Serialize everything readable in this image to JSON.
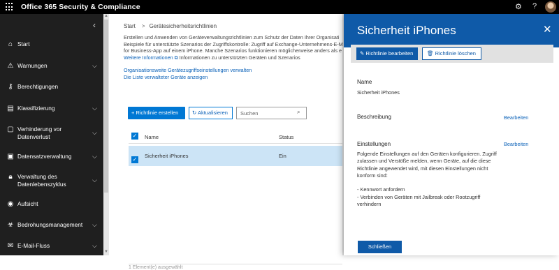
{
  "app": {
    "title": "Office 365 Security & Compliance"
  },
  "topbar_icons": [
    "gear-icon",
    "help-icon",
    "avatar"
  ],
  "nav": {
    "items": [
      {
        "label": "Start",
        "icon": "home-icon",
        "expandable": false
      },
      {
        "label": "Warnungen",
        "icon": "warning-icon",
        "expandable": true
      },
      {
        "label": "Berechtigungen",
        "icon": "key-icon",
        "expandable": false
      },
      {
        "label": "Klassifizierung",
        "icon": "tag-icon",
        "expandable": true
      },
      {
        "label": "Verhinderung vor\nDatenverlust",
        "icon": "document-lock-icon",
        "expandable": true
      },
      {
        "label": "Datensatzverwaltung",
        "icon": "records-icon",
        "expandable": true
      },
      {
        "label": "Verwaltung des\nDatenlebenszyklus",
        "icon": "lock-icon",
        "expandable": true
      },
      {
        "label": "Aufsicht",
        "icon": "eye-icon",
        "expandable": false
      },
      {
        "label": "Bedrohungsmanagement",
        "icon": "biohazard-icon",
        "expandable": true
      },
      {
        "label": "E-Mail-Fluss",
        "icon": "mail-icon",
        "expandable": true
      }
    ]
  },
  "main": {
    "breadcrumb": {
      "home": "Start",
      "separator": ">",
      "current": "Gerätesicherheitsrichtlinien"
    },
    "intro_lines": [
      "Erstellen und Anwenden von Geräteverwaltungsrichtlinien zum Schutz der Daten Ihrer Organisati",
      "Beispiele für unterstützte Szenarios der Zugriffskontrolle: Zugriff auf Exchange-Unternehmens-E-M",
      "for Business-App auf einem iPhone. Manche Szenarios funktionieren möglicherweise anders als e"
    ],
    "more_info_link": "Weitere Informationen",
    "more_info_rest": " Informationen zu unterstützten Geräten und Szenarios",
    "links": [
      "Organisationsweite Gerätezugriffseinstellungen verwalten",
      "Die Liste verwalteter Geräte anzeigen"
    ],
    "toolbar": {
      "create_label": "+ Richtlinie erstellen",
      "refresh_label": "Aktualisieren",
      "search_placeholder": "Suchen"
    },
    "table": {
      "columns": [
        "Name",
        "Status"
      ],
      "rows": [
        {
          "name": "Sicherheit iPhones",
          "status": "Ein",
          "selected": true
        }
      ]
    },
    "footer_partial": "1 Element(e) ausgewählt"
  },
  "panel": {
    "title": "Sicherheit iPhones",
    "edit_policy_label": "Richtlinie bearbeiten",
    "delete_policy_label": "Richtlinie löschen",
    "name_label": "Name",
    "name_value": "Sicherheit iPhones",
    "description_label": "Beschreibung",
    "settings_label": "Einstellungen",
    "edit_link": "Bearbeiten",
    "settings_text": [
      "Folgende Einstellungen auf den Geräten konfigurieren. Zugriff",
      "zulassen und Verstöße melden, wenn Geräte, auf die diese",
      "Richtlinie angewendet wird, mit diesen Einstellungen nicht",
      "konform sind:",
      "",
      "- Kennwort anfordern",
      "- Verbinden von Geräten mit Jailbreak oder Rootzugriff",
      "verhindern"
    ],
    "close_label": "Schließen"
  },
  "colors": {
    "topbar": "#000000",
    "nav": "#1f1f1f",
    "accent": "#0078d4",
    "panel_header": "#0f5aa8",
    "selected_row": "#cce4f6"
  }
}
